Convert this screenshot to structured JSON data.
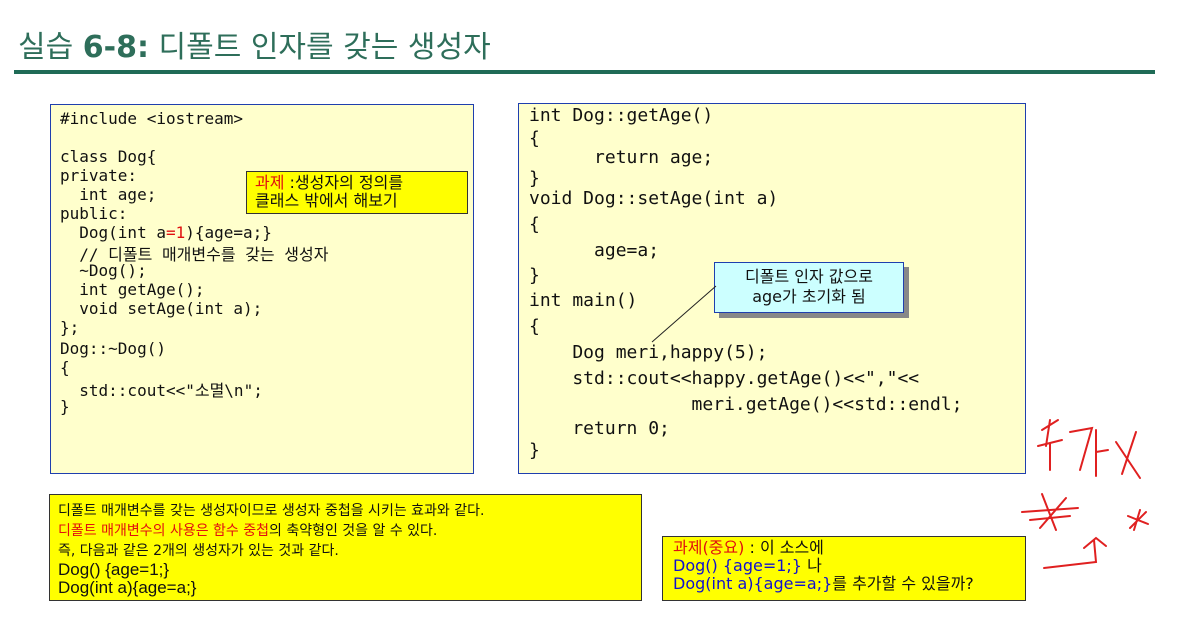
{
  "title": {
    "prefix": "실습 ",
    "number": "6-8:",
    "suffix": " 디폴트 인자를 갖는 생성자"
  },
  "left_code": {
    "lines": [
      "#include <iostream>",
      "",
      "class Dog{",
      "private:",
      "  int age;",
      "public:",
      "  Dog(int a",
      "  // 디폴트 매개변수를 갖는 생성자",
      "  ~Dog();",
      "  int getAge();",
      "  void setAge(int a);",
      "};",
      "Dog::~Dog()",
      "{",
      "  std::cout<<\"소멸\\n\";",
      "}"
    ],
    "default_value": "=1",
    "ctor_tail": "){age=a;}"
  },
  "task1": {
    "label": "과제",
    "line1": " :생성자의 정의를",
    "line2": "클래스 밖에서 해보기"
  },
  "right_code": {
    "lines": [
      "int Dog::getAge()",
      "{",
      "      return age;",
      "}",
      "void Dog::setAge(int a)",
      "{",
      "      age=a;",
      "}",
      "int main()",
      "{",
      "    Dog meri,happy(5);",
      "    std::cout<<happy.getAge()<<\",\"<<",
      "               meri.getAge()<<std::endl;",
      "    return 0;",
      "}"
    ]
  },
  "init_callout": {
    "line1": "디폴트 인자 값으로",
    "line2": "age가 초기화 됨"
  },
  "note": {
    "line1": "디폴트 매개변수를 갖는 생성자이므로 생성자 중첩을 시키는 효과와 같다.",
    "line2_red": "디폴트 매개변수의 사용은 함수 중첩",
    "line2_rest": "의 축약형인 것을 알 수 있다.",
    "line3": "즉, 다음과 같은 2개의 생성자가 있는 것과 같다.",
    "line4": "Dog() {age=1;}",
    "line5": "Dog(int a){age=a;}"
  },
  "task2": {
    "label": "과제(중요)",
    "label_rest": " : 이 소스에",
    "line2_blue": "Dog() {age=1;}",
    "line2_rest": "  나",
    "line3_blue": "Dog(int a){age=a;}",
    "line3_rest": "를 추가할 수 있을까?"
  },
  "colors": {
    "title": "#2e6e5a",
    "code_bg": "#ffffcc",
    "callout_bg": "#ffff00",
    "ink": "#e02020"
  }
}
